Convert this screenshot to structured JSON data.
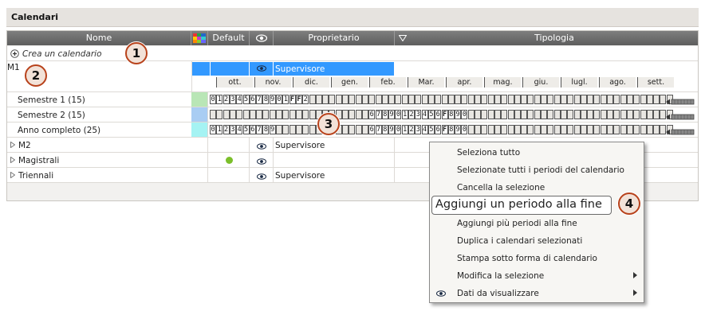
{
  "title": "Calendari",
  "columns": {
    "name": "Nome",
    "default": "Default",
    "owner": "Proprietario",
    "type": "Tipologia"
  },
  "create_label": "Crea un calendario",
  "m1": {
    "name": "M1",
    "owner": "Supervisore"
  },
  "months": [
    "ott.",
    "nov.",
    "dic.",
    "gen.",
    "feb.",
    "Mar.",
    "apr.",
    "mag.",
    "giu.",
    "lugl.",
    "ago.",
    "sett."
  ],
  "periods": [
    {
      "name": "Semestre 1 (15)",
      "color": "#b9e6b6",
      "cells": [
        "0",
        "1",
        "2",
        "3",
        "4",
        "5",
        "6",
        "7",
        "8",
        "9",
        "0",
        "1",
        "F",
        "F",
        "2"
      ]
    },
    {
      "name": "Semestre 2 (15)",
      "color": "#a9cdf3",
      "cells": [
        "6",
        "7",
        "8",
        "9",
        "0",
        "1",
        "2",
        "3",
        "4",
        "5",
        "6",
        "F",
        "8",
        "9",
        "0"
      ]
    },
    {
      "name": "Anno completo (25)",
      "color": "#a5f3f3",
      "cells": [
        "0",
        "1",
        "2",
        "3",
        "4",
        "5",
        "6",
        "7",
        "8",
        "9",
        "6",
        "7",
        "8",
        "9",
        "0",
        "1",
        "2",
        "3",
        "4",
        "5",
        "6",
        "F",
        "8",
        "9",
        "0"
      ]
    }
  ],
  "rows": [
    {
      "name": "M2",
      "owner": "Supervisore"
    },
    {
      "name": "Magistrali",
      "owner": ""
    },
    {
      "name": "Triennali",
      "owner": "Supervisore"
    }
  ],
  "default_dot_color": "#7bbf2a",
  "selection_color": "#3399ff",
  "menu": {
    "items": [
      "Seleziona tutto",
      "Selezionate tutti i periodi del calendario",
      "Cancella la selezione",
      "Aggiungi un periodo alla fine",
      "Aggiungi più periodi alla fine",
      "Duplica i calendari selezionati",
      "Stampa sotto forma di calendario",
      "Modifica la selezione",
      "Dati da visualizzare"
    ]
  },
  "badges": [
    "1",
    "2",
    "3",
    "4"
  ]
}
